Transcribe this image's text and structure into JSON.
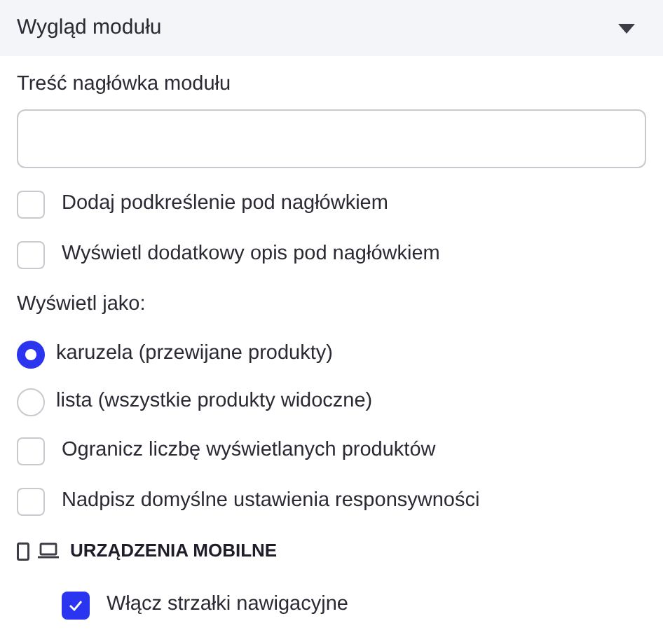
{
  "panel": {
    "title": "Wygląd modułu",
    "expanded": true
  },
  "header_field": {
    "label": "Treść nagłówka modułu"
  },
  "items": [
    {
      "kind": "checkbox",
      "label": "Dodaj podkreślenie pod nagłówkiem",
      "checked": false
    },
    {
      "kind": "checkbox",
      "label": "Wyświetl dodatkowy opis pod nagłówkiem",
      "checked": false
    },
    {
      "kind": "label",
      "label": "Wyświetl jako:"
    },
    {
      "kind": "radio",
      "label": "karuzela (przewijane produkty)",
      "selected": true
    },
    {
      "kind": "radio",
      "label": "lista (wszystkie produkty widoczne)",
      "selected": false
    },
    {
      "kind": "checkbox",
      "label": "Ogranicz liczbę wyświetlanych produktów",
      "checked": false
    },
    {
      "kind": "checkbox",
      "label": "Nadpisz domyślne ustawienia responsywności",
      "checked": false
    }
  ],
  "mobile_section": {
    "title": "URZĄDZENIA MOBILNE",
    "items": [
      {
        "kind": "checkbox",
        "label": "Włącz strzałki nawigacyjne",
        "checked": true
      }
    ]
  }
}
